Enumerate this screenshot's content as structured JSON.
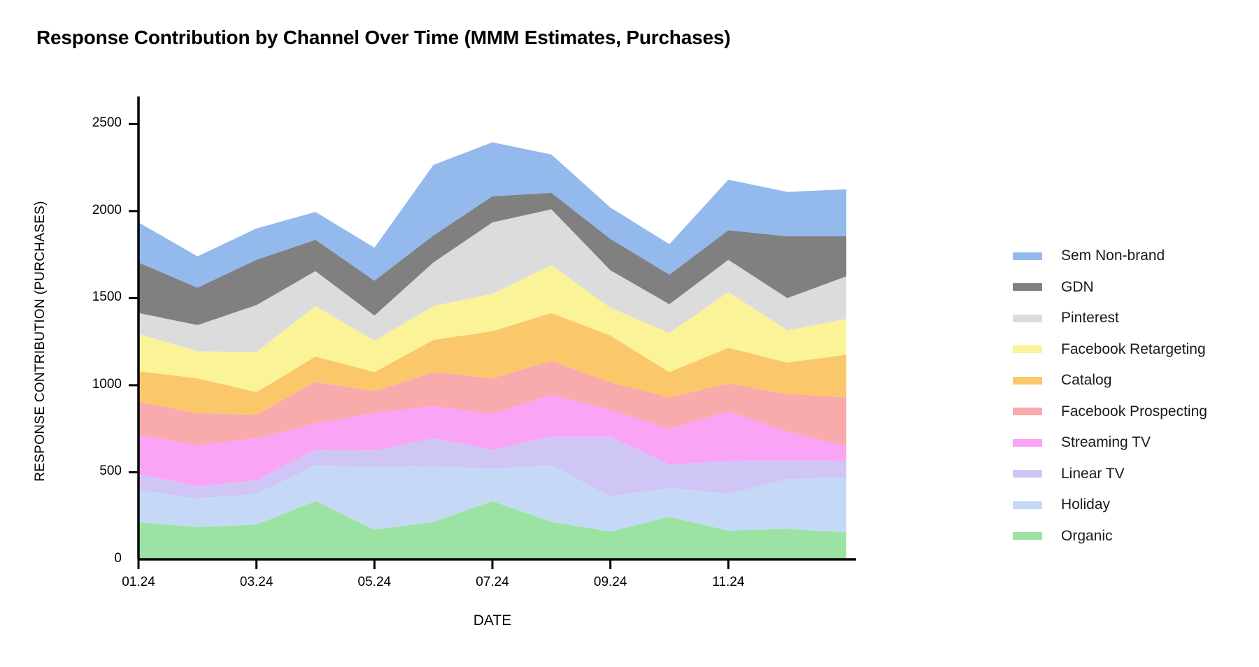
{
  "chart_data": {
    "type": "area",
    "stacked": true,
    "title": "Response Contribution by Channel Over Time (MMM Estimates, Purchases)",
    "xlabel": "DATE",
    "ylabel": "RESPONSE CONTRIBUTION (PURCHASES)",
    "ylim": [
      0,
      2650
    ],
    "yticks": [
      0,
      500,
      1000,
      1500,
      2000,
      2500
    ],
    "ytick_labels": [
      "0",
      "500",
      "1000",
      "1500",
      "2000",
      "2500"
    ],
    "grid": false,
    "legend_position": "right",
    "x": [
      "01.24",
      "02.24",
      "03.24",
      "04.24",
      "05.24",
      "06.24",
      "07.24",
      "08.24",
      "09.24",
      "10.24",
      "11.24",
      "12.24",
      "01.25"
    ],
    "xtick_labels": [
      "01.24",
      "03.24",
      "05.24",
      "07.24",
      "09.24",
      "11.24"
    ],
    "xtick_indices": [
      0,
      2,
      4,
      6,
      8,
      10
    ],
    "series": [
      {
        "name": "Organic",
        "color": "#9CE3A3",
        "values": [
          215,
          185,
          200,
          335,
          170,
          215,
          335,
          215,
          160,
          245,
          165,
          175,
          155
        ]
      },
      {
        "name": "Holiday",
        "color": "#C5D9F7",
        "values": [
          180,
          165,
          175,
          205,
          360,
          320,
          185,
          325,
          200,
          165,
          210,
          285,
          315
        ]
      },
      {
        "name": "Linear TV",
        "color": "#CFC6F5",
        "values": [
          95,
          70,
          80,
          90,
          95,
          160,
          110,
          165,
          345,
          135,
          190,
          110,
          95
        ]
      },
      {
        "name": "Streaming TV",
        "color": "#F9A4F4",
        "values": [
          225,
          235,
          240,
          150,
          215,
          185,
          205,
          240,
          155,
          205,
          285,
          165,
          85
        ]
      },
      {
        "name": "Facebook Prospecting",
        "color": "#F9AAAC",
        "values": [
          190,
          185,
          135,
          240,
          125,
          195,
          205,
          195,
          155,
          180,
          160,
          215,
          280
        ]
      },
      {
        "name": "Catalog",
        "color": "#FBC76B",
        "values": [
          175,
          200,
          130,
          145,
          110,
          185,
          270,
          275,
          270,
          145,
          205,
          180,
          245
        ]
      },
      {
        "name": "Facebook Retargeting",
        "color": "#FBF398",
        "values": [
          215,
          155,
          230,
          290,
          180,
          195,
          215,
          275,
          160,
          225,
          320,
          185,
          205
        ]
      },
      {
        "name": "Pinterest",
        "color": "#DCDCDC",
        "values": [
          120,
          150,
          270,
          200,
          145,
          250,
          410,
          320,
          215,
          165,
          185,
          185,
          245
        ]
      },
      {
        "name": "GDN",
        "color": "#808080",
        "values": [
          290,
          215,
          260,
          180,
          200,
          155,
          150,
          95,
          180,
          170,
          170,
          355,
          230
        ]
      },
      {
        "name": "Sem Non-brand",
        "color": "#93B9ED",
        "values": [
          230,
          180,
          180,
          160,
          190,
          405,
          310,
          220,
          180,
          175,
          290,
          255,
          270
        ]
      }
    ],
    "stack_order_bottom_to_top": [
      "Organic",
      "Holiday",
      "Linear TV",
      "Streaming TV",
      "Facebook Prospecting",
      "Catalog",
      "Facebook Retargeting",
      "Pinterest",
      "GDN",
      "Sem Non-brand"
    ],
    "legend_order_top_to_bottom": [
      "Sem Non-brand",
      "GDN",
      "Pinterest",
      "Facebook Retargeting",
      "Catalog",
      "Facebook Prospecting",
      "Streaming TV",
      "Linear TV",
      "Holiday",
      "Organic"
    ]
  },
  "axis": {
    "line_color": "#000000"
  }
}
